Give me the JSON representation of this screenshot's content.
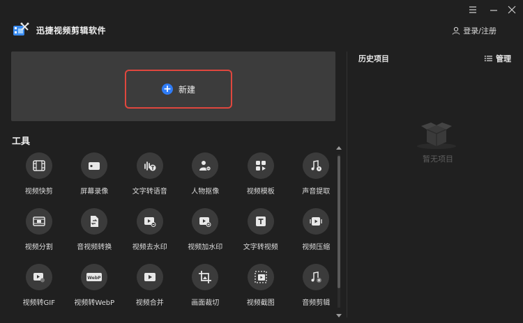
{
  "app": {
    "title": "迅捷视频剪辑软件"
  },
  "header": {
    "login_label": "登录/注册"
  },
  "create": {
    "label": "新建"
  },
  "tools": {
    "title": "工具",
    "items": [
      {
        "label": "视频快剪",
        "icon": "film-clip-icon"
      },
      {
        "label": "屏幕录像",
        "icon": "screen-record-icon"
      },
      {
        "label": "文字转语音",
        "icon": "text-to-speech-icon"
      },
      {
        "label": "人物抠像",
        "icon": "person-cutout-icon"
      },
      {
        "label": "视频模板",
        "icon": "video-template-icon"
      },
      {
        "label": "声音提取",
        "icon": "audio-extract-icon"
      },
      {
        "label": "视频分割",
        "icon": "video-split-icon"
      },
      {
        "label": "音视频转换",
        "icon": "av-convert-icon"
      },
      {
        "label": "视频去水印",
        "icon": "remove-watermark-icon"
      },
      {
        "label": "视频加水印",
        "icon": "add-watermark-icon"
      },
      {
        "label": "文字转视频",
        "icon": "text-to-video-icon"
      },
      {
        "label": "视频压缩",
        "icon": "video-compress-icon"
      },
      {
        "label": "视频转GIF",
        "icon": "video-to-gif-icon"
      },
      {
        "label": "视频转WebP",
        "icon": "video-to-webp-icon",
        "badge": "WebP"
      },
      {
        "label": "视频合并",
        "icon": "video-merge-icon"
      },
      {
        "label": "画面裁切",
        "icon": "crop-icon"
      },
      {
        "label": "视频截图",
        "icon": "video-screenshot-icon"
      },
      {
        "label": "音频剪辑",
        "icon": "audio-cut-icon"
      }
    ]
  },
  "history": {
    "title": "历史项目",
    "manage_label": "管理",
    "empty_text": "暂无项目"
  },
  "colors": {
    "accent": "#2f7cf6",
    "highlight": "#e0473e",
    "panel": "#3c3c3c",
    "background": "#202020"
  }
}
